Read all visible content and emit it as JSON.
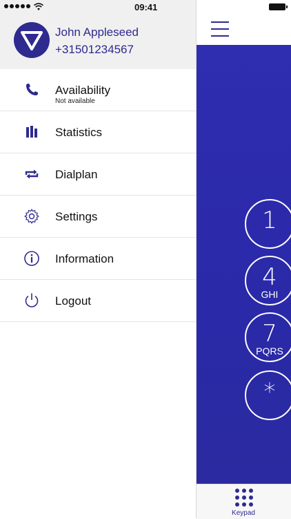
{
  "status": {
    "time": "09:41"
  },
  "profile": {
    "name": "John Appleseed",
    "number": "+31501234567"
  },
  "menu": [
    {
      "label": "Availability",
      "sublabel": "Not available",
      "icon": "phone-icon"
    },
    {
      "label": "Statistics",
      "icon": "bar-chart-icon"
    },
    {
      "label": "Dialplan",
      "icon": "repeat-arrows-icon"
    },
    {
      "label": "Settings",
      "icon": "gear-icon"
    },
    {
      "label": "Information",
      "icon": "info-icon"
    },
    {
      "label": "Logout",
      "icon": "power-icon"
    }
  ],
  "keypad": [
    {
      "digit": "1",
      "letters": ""
    },
    {
      "digit": "4",
      "letters": "GHI"
    },
    {
      "digit": "7",
      "letters": "PQRS"
    },
    {
      "digit": "*",
      "letters": ""
    }
  ],
  "tabbar": {
    "keypad_label": "Keypad"
  },
  "colors": {
    "brand": "#2e2a8f",
    "keypad_bg": "#2d2cad"
  }
}
